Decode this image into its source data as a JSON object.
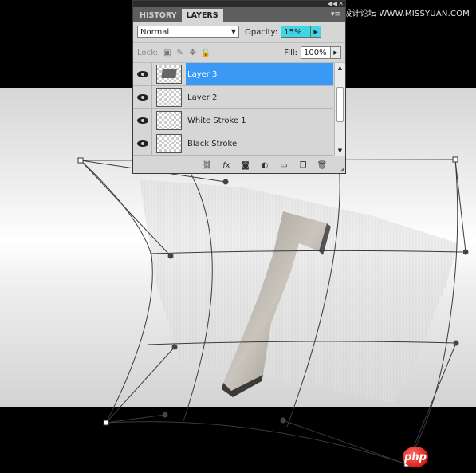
{
  "watermark": "思缘设计论坛 WWW.MISSYUAN.COM",
  "panel": {
    "tabs": [
      {
        "label": "HISTORY",
        "active": false
      },
      {
        "label": "LAYERS",
        "active": true
      }
    ],
    "blend_mode": "Normal",
    "opacity_label": "Opacity:",
    "opacity_value": "15%",
    "lock_label": "Lock:",
    "fill_label": "Fill:",
    "fill_value": "100%",
    "layers": [
      {
        "name": "Layer 3",
        "visible": true,
        "selected": true
      },
      {
        "name": "Layer 2",
        "visible": true,
        "selected": false
      },
      {
        "name": "White Stroke 1",
        "visible": true,
        "selected": false
      },
      {
        "name": "Black Stroke",
        "visible": true,
        "selected": false
      }
    ],
    "footer_icons": [
      "link-icon",
      "fx-icon",
      "mask-icon",
      "adjustment-icon",
      "group-icon",
      "new-layer-icon",
      "trash-icon"
    ]
  },
  "badge": "php",
  "colors": {
    "selected_layer": "#3a99f5",
    "opacity_field": "#3fd6e6"
  }
}
